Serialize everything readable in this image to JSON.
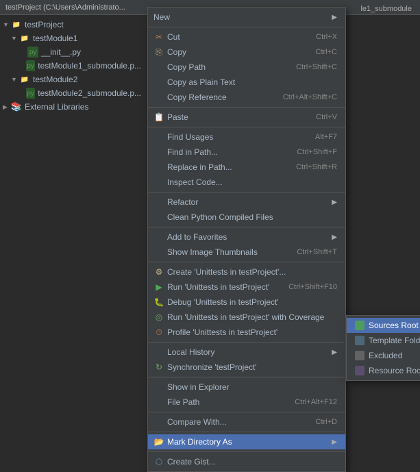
{
  "title_bar": {
    "text": "testProject (C:\\Users\\Administrato..."
  },
  "top_right_label": "le1_submodule",
  "tree": {
    "items": [
      {
        "id": "testProject",
        "label": "testProject",
        "indent": 0,
        "type": "folder",
        "expanded": true,
        "arrow": "▼"
      },
      {
        "id": "testModule1",
        "label": "testModule1",
        "indent": 1,
        "type": "folder",
        "expanded": true,
        "arrow": "▼"
      },
      {
        "id": "__init__",
        "label": "__init__.py",
        "indent": 2,
        "type": "py",
        "arrow": ""
      },
      {
        "id": "testModule1_sub",
        "label": "testModule1_submodule.p...",
        "indent": 2,
        "type": "py",
        "arrow": ""
      },
      {
        "id": "testModule2",
        "label": "testModule2",
        "indent": 1,
        "type": "folder",
        "expanded": true,
        "arrow": "▼"
      },
      {
        "id": "testModule2_sub",
        "label": "testModule2_submodule.p...",
        "indent": 2,
        "type": "py",
        "arrow": ""
      },
      {
        "id": "ext_libs",
        "label": "External Libraries",
        "indent": 0,
        "type": "ext",
        "expanded": false,
        "arrow": "▶"
      }
    ]
  },
  "context_menu": {
    "sections": [
      {
        "items": [
          {
            "label": "New",
            "shortcut": "",
            "has_submenu": true,
            "icon": ""
          }
        ]
      },
      {
        "divider": true,
        "items": [
          {
            "label": "Cut",
            "shortcut": "Ctrl+X",
            "icon": "cut"
          },
          {
            "label": "Copy",
            "shortcut": "Ctrl+C",
            "icon": "copy"
          },
          {
            "label": "Copy Path",
            "shortcut": "Ctrl+Shift+C",
            "icon": ""
          },
          {
            "label": "Copy as Plain Text",
            "shortcut": "",
            "icon": ""
          },
          {
            "label": "Copy Reference",
            "shortcut": "Ctrl+Alt+Shift+C",
            "icon": ""
          }
        ]
      },
      {
        "divider": true,
        "items": [
          {
            "label": "Paste",
            "shortcut": "Ctrl+V",
            "icon": "paste"
          }
        ]
      },
      {
        "divider": true,
        "items": [
          {
            "label": "Find Usages",
            "shortcut": "Alt+F7",
            "icon": ""
          },
          {
            "label": "Find in Path...",
            "shortcut": "Ctrl+Shift+F",
            "icon": ""
          },
          {
            "label": "Replace in Path...",
            "shortcut": "Ctrl+Shift+R",
            "icon": ""
          },
          {
            "label": "Inspect Code...",
            "shortcut": "",
            "icon": ""
          }
        ]
      },
      {
        "divider": true,
        "items": [
          {
            "label": "Refactor",
            "shortcut": "",
            "has_submenu": true,
            "icon": ""
          },
          {
            "label": "Clean Python Compiled Files",
            "shortcut": "",
            "icon": ""
          }
        ]
      },
      {
        "divider": true,
        "items": [
          {
            "label": "Add to Favorites",
            "shortcut": "",
            "has_submenu": true,
            "icon": ""
          },
          {
            "label": "Show Image Thumbnails",
            "shortcut": "Ctrl+Shift+T",
            "icon": ""
          }
        ]
      },
      {
        "divider": true,
        "items": [
          {
            "label": "Create 'Unittests in testProject'...",
            "shortcut": "",
            "icon": "create-test"
          },
          {
            "label": "Run 'Unittests in testProject'",
            "shortcut": "Ctrl+Shift+F10",
            "icon": "run"
          },
          {
            "label": "Debug 'Unittests in testProject'",
            "shortcut": "",
            "icon": "debug"
          },
          {
            "label": "Run 'Unittests in testProject' with Coverage",
            "shortcut": "",
            "icon": "coverage"
          },
          {
            "label": "Profile 'Unittests in testProject'",
            "shortcut": "",
            "icon": "profile"
          }
        ]
      },
      {
        "divider": true,
        "items": [
          {
            "label": "Local History",
            "shortcut": "",
            "has_submenu": true,
            "icon": ""
          },
          {
            "label": "Synchronize 'testProject'",
            "shortcut": "",
            "icon": "sync"
          }
        ]
      },
      {
        "divider": true,
        "items": [
          {
            "label": "Show in Explorer",
            "shortcut": "",
            "icon": ""
          },
          {
            "label": "File Path",
            "shortcut": "Ctrl+Alt+F12",
            "icon": ""
          }
        ]
      },
      {
        "divider": true,
        "items": [
          {
            "label": "Compare With...",
            "shortcut": "Ctrl+D",
            "icon": ""
          }
        ]
      },
      {
        "divider": true,
        "items": [
          {
            "label": "Mark Directory As",
            "shortcut": "",
            "has_submenu": true,
            "icon": "markdir",
            "highlighted": true
          }
        ]
      },
      {
        "divider": false,
        "items": [
          {
            "label": "Create Gist...",
            "shortcut": "",
            "icon": "gist"
          }
        ]
      }
    ]
  },
  "submenu": {
    "items": [
      {
        "label": "Sources Root",
        "type": "sources_root",
        "active": true
      },
      {
        "label": "Template Folder",
        "type": "template",
        "active": false
      },
      {
        "label": "Excluded",
        "type": "excluded",
        "active": false
      },
      {
        "label": "Resource Root",
        "type": "resource_root",
        "active": false
      }
    ]
  }
}
